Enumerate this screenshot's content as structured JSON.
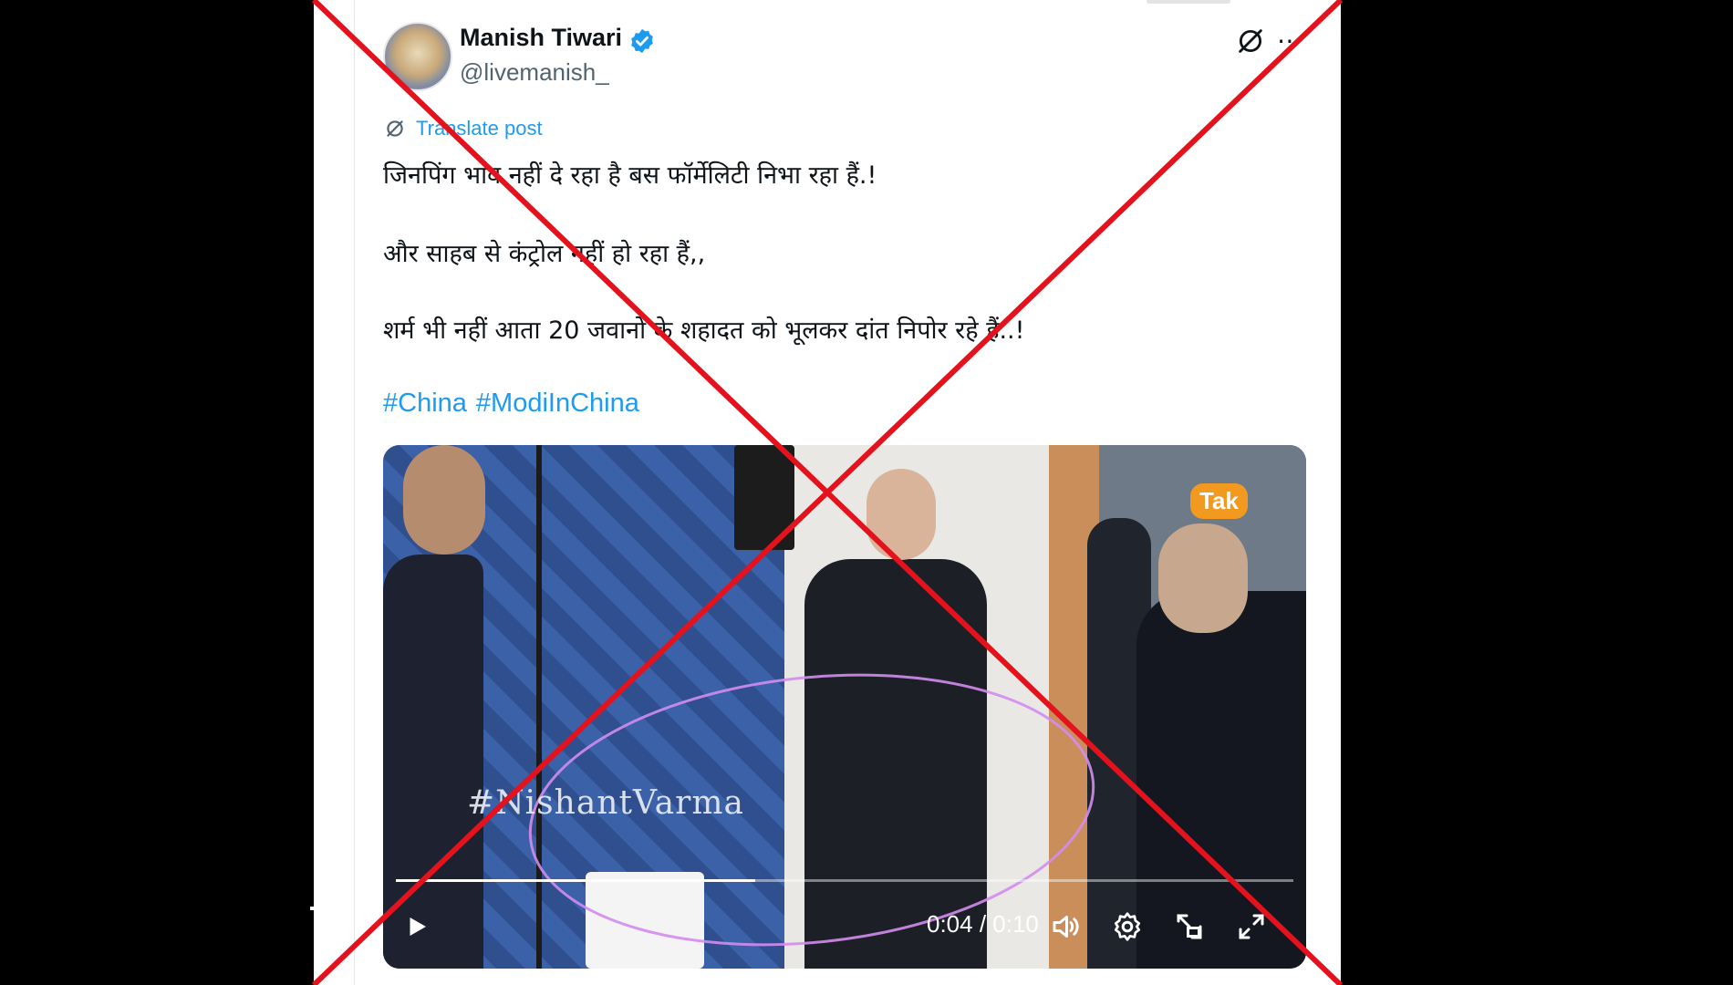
{
  "post": {
    "author_name": "Manish Tiwari",
    "author_handle": "@livemanish_",
    "translate_label": "Translate post",
    "lines": [
      "जिनपिंग भाव नहीं दे रहा है बस फॉर्मेलिटी निभा रहा हैं.!",
      "और साहब से कंट्रोल नहीं हो रहा हैं,,",
      "शर्म भी नहीं आता 20 जवानों के शहादत को भूलकर दांत निपोर रहे हैं..!"
    ],
    "hashtags": [
      "#China",
      "#ModiInChina"
    ]
  },
  "video": {
    "badge_text": "Tak",
    "watermark_text": "#NishantVarma",
    "time_display": "0:04 / 0:10",
    "progress_fraction": 0.4
  },
  "icons": {
    "verified": "verified-badge-icon",
    "grok": "grok-icon",
    "more": "more-icon",
    "play": "play-icon",
    "volume": "volume-icon",
    "settings": "settings-icon",
    "pip": "picture-in-picture-icon",
    "fullscreen": "fullscreen-icon"
  },
  "colors": {
    "accent": "#1d9bf0",
    "cross": "#e3121c",
    "text": "#0f1419",
    "muted": "#536471"
  }
}
